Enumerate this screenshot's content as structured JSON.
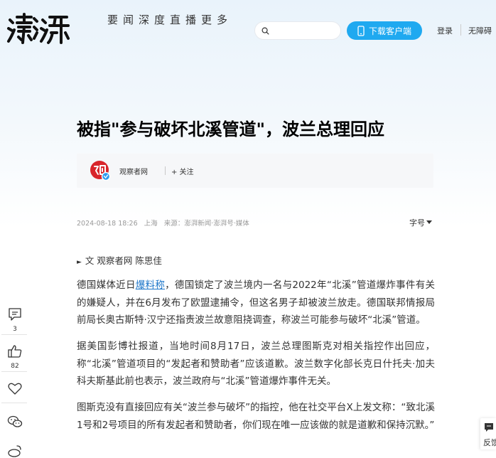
{
  "header": {
    "logo_text": "澎湃",
    "nav": [
      {
        "label": "要闻"
      },
      {
        "label": "深度"
      },
      {
        "label": "直播"
      },
      {
        "label": "更多"
      }
    ],
    "search_placeholder": "",
    "download_label": "下载客户端",
    "login_label": "登录",
    "accessibility_label": "无障碍"
  },
  "article": {
    "title": "被指\"参与破坏北溪管道\"，波兰总理回应",
    "author_name": "观察者网",
    "follow_label": "+ 关注",
    "date": "2024-08-18 18:26",
    "location": "上海",
    "source": "来源：澎湃新闻·澎湃号·媒体",
    "font_size_label": "字号",
    "byline": "文 观察者网 陈思佳",
    "p1_before_link": "德国媒体近日",
    "p1_link": "爆料称",
    "p1_after_link": "，德国锁定了波兰境内一名与2022年“北溪”管道爆炸事件有关的嫌疑人，并在6月发布了欧盟逮捕令，但这名男子却被波兰放走。德国联邦情报局前局长奥古斯特·汉宁还指责波兰故意阻挠调查，称波兰可能参与破坏“北溪”管道。",
    "p2": "据美国彭博社报道，当地时间8月17日，波兰总理图斯克对相关指控作出回应，称“北溪”管道项目的“发起者和赞助者”应该道歉。波兰数字化部长克日什托夫·加夫科夫斯基此前也表示，波兰政府与“北溪”管道爆炸事件无关。",
    "p3": "图斯克没有直接回应有关“波兰参与破坏”的指控，他在社交平台X上发文称：“致北溪1号和2号项目的所有发起者和赞助者，你们现在唯一应该做的就是道歉和保持沉默。”"
  },
  "rail": {
    "comment_count": "3",
    "like_count": "82"
  },
  "feedback_label": "反馈",
  "colors": {
    "accent_blue": "#1fa9f0",
    "link_blue": "#1a74c8",
    "avatar_red": "#d8252b"
  }
}
